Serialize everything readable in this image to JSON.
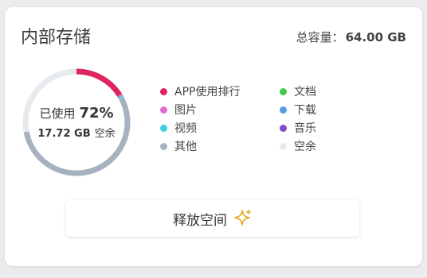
{
  "card": {
    "title": "内部存储",
    "capacity_label": "总容量：",
    "capacity_value": "64.00 GB"
  },
  "usage": {
    "used_label": "已使用",
    "used_percent_text": "72%",
    "used_fraction": 0.72,
    "free_amount": "17.72 GB",
    "free_label": "空余"
  },
  "legend": [
    {
      "label": "APP使用排行",
      "color": "#e0245e"
    },
    {
      "label": "文档",
      "color": "#3fc64b"
    },
    {
      "label": "图片",
      "color": "#e26bcd"
    },
    {
      "label": "下载",
      "color": "#5a9be6"
    },
    {
      "label": "视频",
      "color": "#42cde6"
    },
    {
      "label": "音乐",
      "color": "#8a4ac6"
    },
    {
      "label": "其他",
      "color": "#a6b2c0"
    },
    {
      "label": "空余",
      "color": "#e6e9ee"
    }
  ],
  "ring_segments": [
    {
      "category": "APP使用排行",
      "fraction": 0.16,
      "color": "#e0245e"
    },
    {
      "category": "图片",
      "fraction": 0.005,
      "color": "#e26bcd"
    },
    {
      "category": "视频",
      "fraction": 0.005,
      "color": "#42cde6"
    },
    {
      "category": "其他",
      "fraction": 0.55,
      "color": "#a6b2c0"
    },
    {
      "category": "空余",
      "fraction": 0.28,
      "color": "#e6e9ee"
    }
  ],
  "free_button": {
    "label": "释放空间",
    "icon": "sparkle-icon",
    "icon_color": "#e8a317"
  }
}
